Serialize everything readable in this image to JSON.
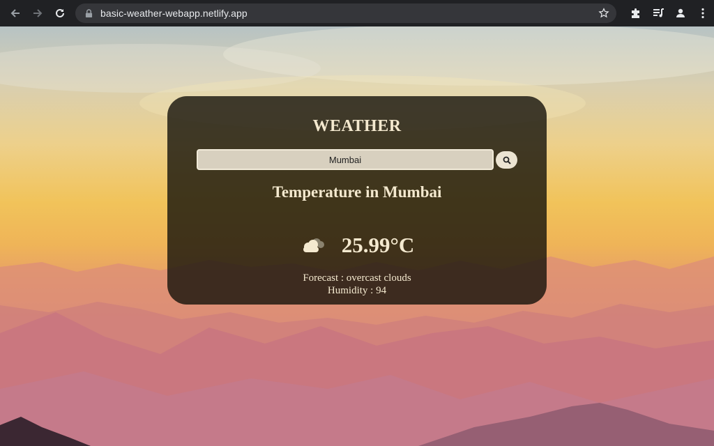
{
  "browser": {
    "url": "basic-weather-webapp.netlify.app"
  },
  "card": {
    "title": "WEATHER",
    "search_value": "Mumbai",
    "heading": "Temperature in Mumbai",
    "weather_icon": "cloud-icon",
    "temperature": "25.99°C",
    "forecast": "Forecast : overcast clouds",
    "humidity": "Humidity : 94"
  },
  "colors": {
    "card_bg": "#14120a",
    "card_text": "#f4e9cf",
    "input_bg": "#d8d0bf",
    "chrome_bg": "#202124",
    "omnibox_bg": "#35363a"
  }
}
